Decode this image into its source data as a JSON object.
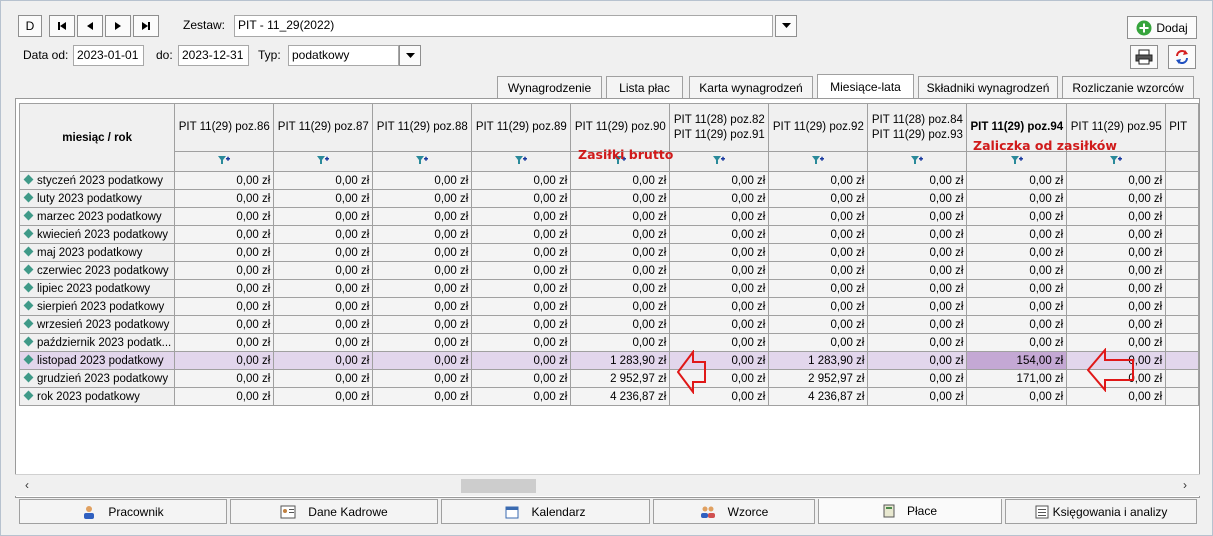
{
  "toolbar": {
    "nav_first_label": "D",
    "zestaw_label": "Zestaw:",
    "zestaw_value": "PIT - 11_29(2022)",
    "data_od_label": "Data od:",
    "data_od_value": "2023-01-01",
    "do_label": "do:",
    "do_value": "2023-12-31",
    "typ_label": "Typ:",
    "typ_value": "podatkowy",
    "dodaj_label": "Dodaj"
  },
  "tabs": [
    {
      "label": "Wynagrodzenie"
    },
    {
      "label": "Lista płac"
    },
    {
      "label": "Karta wynagrodzeń"
    },
    {
      "label": "Miesiące-lata",
      "active": true
    },
    {
      "label": "Składniki wynagrodzeń"
    },
    {
      "label": "Rozliczanie wzorców"
    }
  ],
  "grid": {
    "corner_label": "miesiąc / rok",
    "columns": [
      {
        "l1": "PIT 11(29) poz.86",
        "l2": ""
      },
      {
        "l1": "PIT 11(29) poz.87",
        "l2": ""
      },
      {
        "l1": "PIT 11(29) poz.88",
        "l2": ""
      },
      {
        "l1": "PIT 11(29) poz.89",
        "l2": ""
      },
      {
        "l1": "PIT 11(29) poz.90",
        "l2": ""
      },
      {
        "l1": "PIT 11(28) poz.82",
        "l2": "PIT 11(29) poz.91"
      },
      {
        "l1": "PIT 11(29) poz.92",
        "l2": ""
      },
      {
        "l1": "PIT 11(28) poz.84",
        "l2": "PIT 11(29) poz.93"
      },
      {
        "l1": "PIT 11(29) poz.94",
        "l2": "",
        "bold": true
      },
      {
        "l1": "PIT 11(29) poz.95",
        "l2": ""
      },
      {
        "l1": "PIT",
        "l2": ""
      }
    ],
    "rows": [
      {
        "label": "styczeń 2023 podatkowy",
        "values": [
          "0,00 zł",
          "0,00 zł",
          "0,00 zł",
          "0,00 zł",
          "0,00 zł",
          "0,00 zł",
          "0,00 zł",
          "0,00 zł",
          "0,00 zł",
          "0,00 zł"
        ]
      },
      {
        "label": "luty 2023 podatkowy",
        "values": [
          "0,00 zł",
          "0,00 zł",
          "0,00 zł",
          "0,00 zł",
          "0,00 zł",
          "0,00 zł",
          "0,00 zł",
          "0,00 zł",
          "0,00 zł",
          "0,00 zł"
        ]
      },
      {
        "label": "marzec 2023 podatkowy",
        "values": [
          "0,00 zł",
          "0,00 zł",
          "0,00 zł",
          "0,00 zł",
          "0,00 zł",
          "0,00 zł",
          "0,00 zł",
          "0,00 zł",
          "0,00 zł",
          "0,00 zł"
        ]
      },
      {
        "label": "kwiecień 2023 podatkowy",
        "values": [
          "0,00 zł",
          "0,00 zł",
          "0,00 zł",
          "0,00 zł",
          "0,00 zł",
          "0,00 zł",
          "0,00 zł",
          "0,00 zł",
          "0,00 zł",
          "0,00 zł"
        ]
      },
      {
        "label": "maj 2023 podatkowy",
        "values": [
          "0,00 zł",
          "0,00 zł",
          "0,00 zł",
          "0,00 zł",
          "0,00 zł",
          "0,00 zł",
          "0,00 zł",
          "0,00 zł",
          "0,00 zł",
          "0,00 zł"
        ]
      },
      {
        "label": "czerwiec 2023 podatkowy",
        "values": [
          "0,00 zł",
          "0,00 zł",
          "0,00 zł",
          "0,00 zł",
          "0,00 zł",
          "0,00 zł",
          "0,00 zł",
          "0,00 zł",
          "0,00 zł",
          "0,00 zł"
        ]
      },
      {
        "label": "lipiec 2023 podatkowy",
        "values": [
          "0,00 zł",
          "0,00 zł",
          "0,00 zł",
          "0,00 zł",
          "0,00 zł",
          "0,00 zł",
          "0,00 zł",
          "0,00 zł",
          "0,00 zł",
          "0,00 zł"
        ]
      },
      {
        "label": "sierpień 2023 podatkowy",
        "values": [
          "0,00 zł",
          "0,00 zł",
          "0,00 zł",
          "0,00 zł",
          "0,00 zł",
          "0,00 zł",
          "0,00 zł",
          "0,00 zł",
          "0,00 zł",
          "0,00 zł"
        ]
      },
      {
        "label": "wrzesień 2023 podatkowy",
        "values": [
          "0,00 zł",
          "0,00 zł",
          "0,00 zł",
          "0,00 zł",
          "0,00 zł",
          "0,00 zł",
          "0,00 zł",
          "0,00 zł",
          "0,00 zł",
          "0,00 zł"
        ]
      },
      {
        "label": "październik 2023 podatk...",
        "values": [
          "0,00 zł",
          "0,00 zł",
          "0,00 zł",
          "0,00 zł",
          "0,00 zł",
          "0,00 zł",
          "0,00 zł",
          "0,00 zł",
          "0,00 zł",
          "0,00 zł"
        ]
      },
      {
        "label": "listopad 2023 podatkowy",
        "values": [
          "0,00 zł",
          "0,00 zł",
          "0,00 zł",
          "0,00 zł",
          "1 283,90 zł",
          "0,00 zł",
          "1 283,90 zł",
          "0,00 zł",
          "154,00 zł",
          "0,00 zł"
        ],
        "selected": true
      },
      {
        "label": "grudzień 2023 podatkowy",
        "values": [
          "0,00 zł",
          "0,00 zł",
          "0,00 zł",
          "0,00 zł",
          "2 952,97 zł",
          "0,00 zł",
          "2 952,97 zł",
          "0,00 zł",
          "171,00 zł",
          "0,00 zł"
        ]
      },
      {
        "label": "rok 2023 podatkowy",
        "values": [
          "0,00 zł",
          "0,00 zł",
          "0,00 zł",
          "0,00 zł",
          "4 236,87 zł",
          "0,00 zł",
          "4 236,87 zł",
          "0,00 zł",
          "0,00 zł",
          "0,00 zł"
        ]
      }
    ]
  },
  "annotations": {
    "zasilki_brutto": "Zasiłki brutto",
    "zaliczka": "Zaliczka od zasiłków"
  },
  "bottom_tabs": [
    {
      "label": "Pracownik"
    },
    {
      "label": "Dane Kadrowe"
    },
    {
      "label": "Kalendarz"
    },
    {
      "label": "Wzorce"
    },
    {
      "label": "Płace",
      "active": true
    },
    {
      "label": "Księgowania i analizy"
    }
  ],
  "colors": {
    "selected_row": "#e2d6ec",
    "selected_cell": "#c4a8d4",
    "annotation": "#d01a1a"
  }
}
